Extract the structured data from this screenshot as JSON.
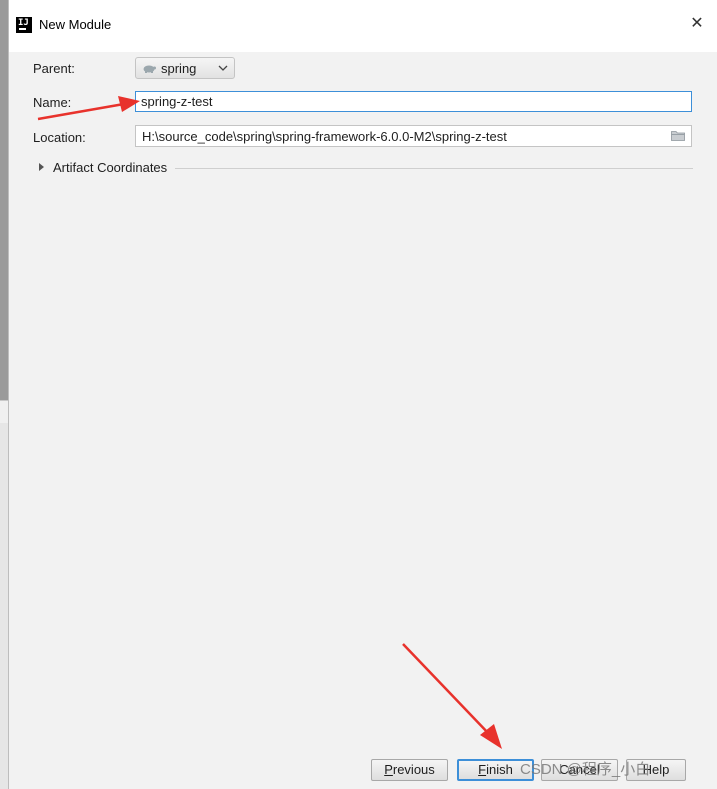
{
  "dialog": {
    "title": "New Module",
    "close_glyph": "✕",
    "icon": "intellij-icon",
    "icon_text": "IJ"
  },
  "form": {
    "parent_label": "Parent:",
    "parent_value": "spring",
    "name_label": "Name:",
    "name_value": "spring-z-test",
    "location_label": "Location:",
    "location_value": "H:\\source_code\\spring\\spring-framework-6.0.0-M2\\spring-z-test",
    "artifact_label": "Artifact Coordinates"
  },
  "buttons": {
    "previous": {
      "mnemonic": "P",
      "rest": "revious"
    },
    "finish": {
      "mnemonic": "F",
      "rest": "inish"
    },
    "cancel": {
      "label": "Cancel"
    },
    "help": {
      "label": "Help"
    }
  },
  "watermark": "CSDN @程序_小白",
  "colors": {
    "focus": "#3d8fd8",
    "annotation_arrow": "#e8322c",
    "dialog_bg": "#f2f2f2"
  }
}
